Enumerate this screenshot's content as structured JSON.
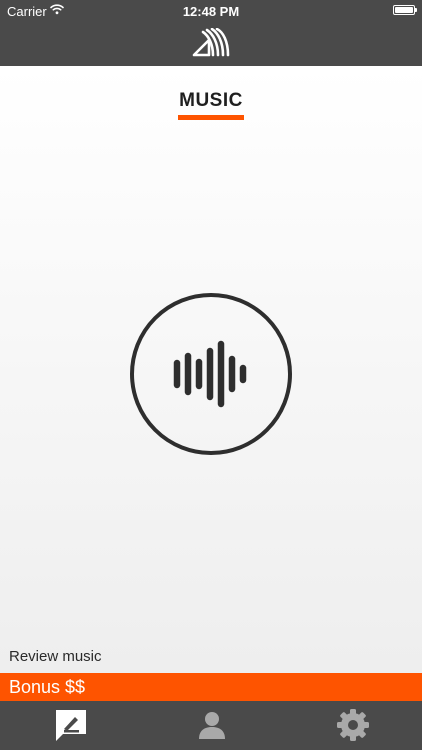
{
  "status_bar": {
    "carrier": "Carrier",
    "time": "12:48 PM"
  },
  "nav_bar": {
    "logo_icon": "app-logo-icon"
  },
  "main": {
    "section_tab": "MUSIC",
    "record_button_icon": "sound-wave-icon",
    "review_label": "Review music"
  },
  "bonus_bar": {
    "text": "Bonus $$"
  },
  "tab_bar": {
    "tabs": [
      {
        "icon": "write-review-icon",
        "selected": true
      },
      {
        "icon": "profile-icon",
        "selected": false
      },
      {
        "icon": "settings-gear-icon",
        "selected": false
      }
    ]
  },
  "colors": {
    "accent": "#fe5400",
    "bar_background": "#4a4a4a",
    "icon_dark": "#2e2e2e"
  }
}
